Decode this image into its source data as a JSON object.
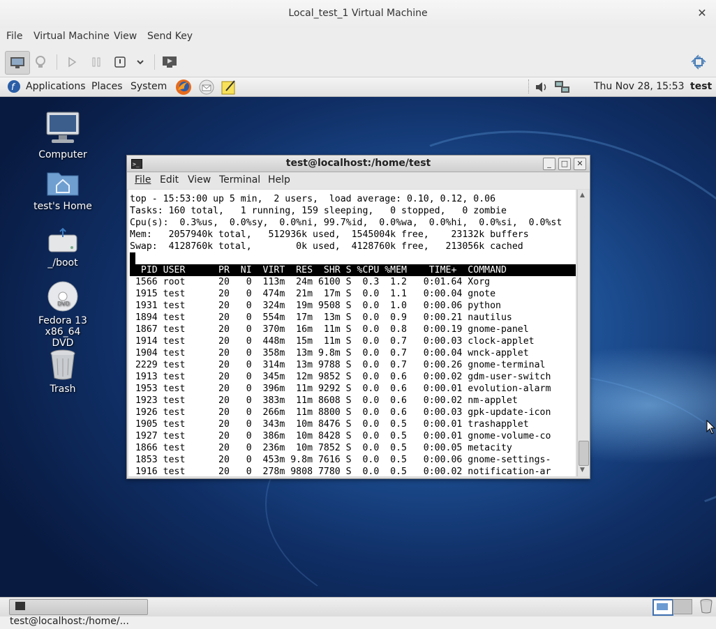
{
  "vm": {
    "title": "Local_test_1 Virtual Machine",
    "menu": [
      "File",
      "Virtual Machine",
      "View",
      "Send Key"
    ]
  },
  "guest_panel": {
    "applications": "Applications",
    "places": "Places",
    "system": "System",
    "clock": "Thu Nov 28, 15:53",
    "user": "test"
  },
  "desktop_icons": [
    "Computer",
    "test's Home",
    "_/boot",
    "Fedora 13 x86_64\nDVD",
    "Trash"
  ],
  "terminal": {
    "title": "test@localhost:/home/test",
    "menu": [
      "File",
      "Edit",
      "View",
      "Terminal",
      "Help"
    ],
    "top_summary": "top - 15:53:00 up 5 min,  2 users,  load average: 0.10, 0.12, 0.06\nTasks: 160 total,   1 running, 159 sleeping,   0 stopped,   0 zombie\nCpu(s):  0.3%us,  0.0%sy,  0.0%ni, 99.7%id,  0.0%wa,  0.0%hi,  0.0%si,  0.0%st\nMem:   2057940k total,   512936k used,  1545004k free,    23132k buffers\nSwap:  4128760k total,        0k used,  4128760k free,   213056k cached",
    "columns": "  PID USER      PR  NI  VIRT  RES  SHR S %CPU %MEM    TIME+  COMMAND",
    "processes": " 1566 root      20   0  113m  24m 6100 S  0.3  1.2   0:01.64 Xorg\n 1915 test      20   0  474m  21m  17m S  0.0  1.1   0:00.04 gnote\n 1931 test      20   0  324m  19m 9508 S  0.0  1.0   0:00.06 python\n 1894 test      20   0  554m  17m  13m S  0.0  0.9   0:00.21 nautilus\n 1867 test      20   0  370m  16m  11m S  0.0  0.8   0:00.19 gnome-panel\n 1914 test      20   0  448m  15m  11m S  0.0  0.7   0:00.03 clock-applet\n 1904 test      20   0  358m  13m 9.8m S  0.0  0.7   0:00.04 wnck-applet\n 2229 test      20   0  314m  13m 9788 S  0.0  0.7   0:00.26 gnome-terminal\n 1913 test      20   0  345m  12m 9852 S  0.0  0.6   0:00.02 gdm-user-switch\n 1953 test      20   0  396m  11m 9292 S  0.0  0.6   0:00.01 evolution-alarm\n 1923 test      20   0  383m  11m 8608 S  0.0  0.6   0:00.02 nm-applet\n 1926 test      20   0  266m  11m 8800 S  0.0  0.6   0:00.03 gpk-update-icon\n 1905 test      20   0  343m  10m 8476 S  0.0  0.5   0:00.01 trashapplet\n 1927 test      20   0  386m  10m 8428 S  0.0  0.5   0:00.01 gnome-volume-co\n 1866 test      20   0  236m  10m 7852 S  0.0  0.5   0:00.05 metacity\n 1853 test      20   0  453m 9.8m 7616 S  0.0  0.5   0:00.06 gnome-settings-\n 1916 test      20   0  278m 9808 7780 S  0.0  0.5   0:00.02 notification-ar"
  },
  "taskbar": {
    "window_button": "test@localhost:/home/..."
  }
}
